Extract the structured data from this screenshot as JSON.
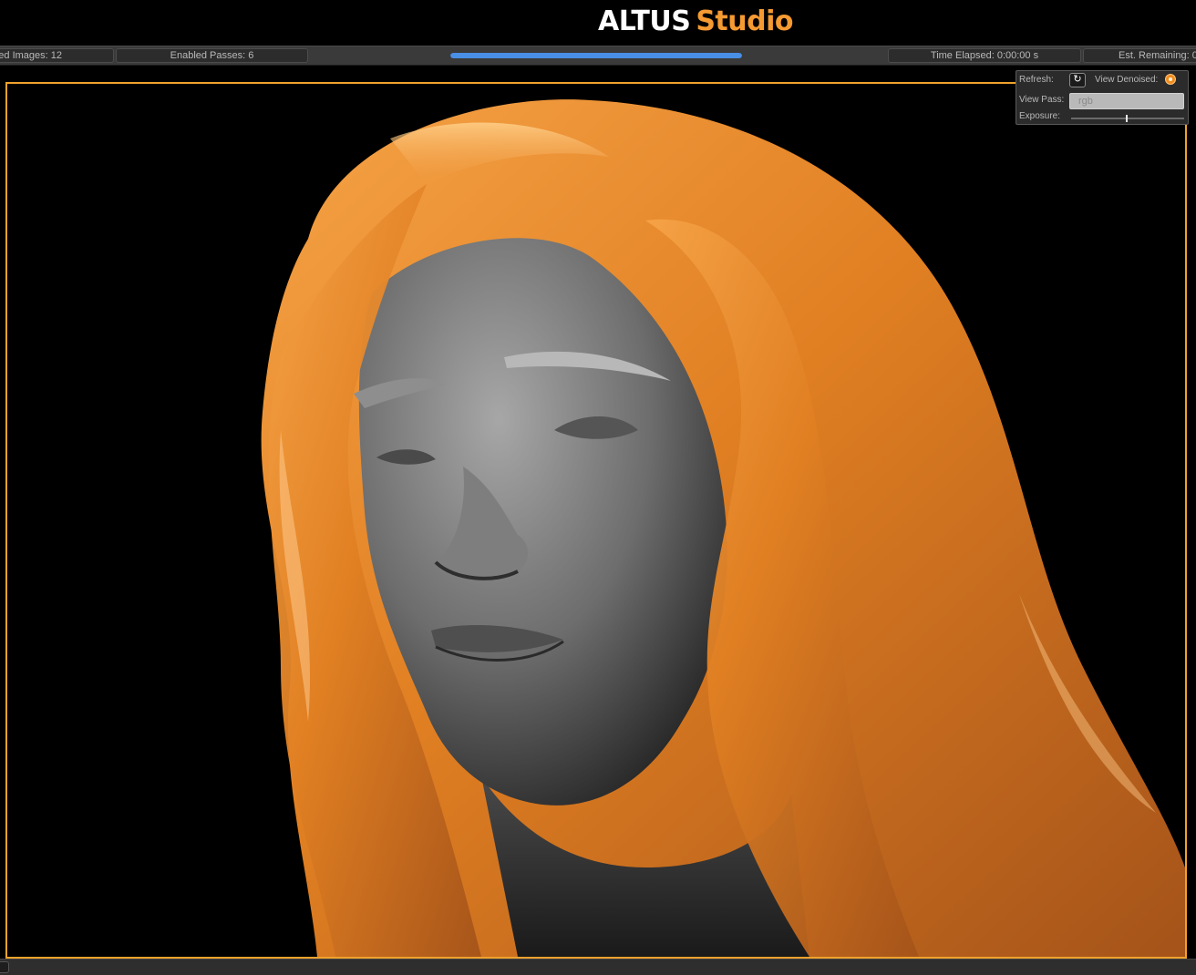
{
  "app": {
    "brand_primary": "ALTUS",
    "brand_secondary": "Studio",
    "accent_color": "#f59a32"
  },
  "status_bar": {
    "loaded_images": "ed Images: 12",
    "enabled_passes": "Enabled Passes: 6",
    "progress_fraction": 1.0,
    "time_elapsed": "Time Elapsed: 0:00:00 s",
    "est_remaining": "Est. Remaining: 0"
  },
  "viewer": {
    "refresh_label": "Refresh:",
    "refresh_icon": "refresh-icon",
    "view_denoised_label": "View Denoised:",
    "view_denoised_on": true,
    "view_pass_label": "View Pass:",
    "view_pass_value": "rgb",
    "exposure_label": "Exposure:"
  },
  "viewport": {
    "content": "render-preview-image",
    "frame_color": "#f0a22c"
  }
}
